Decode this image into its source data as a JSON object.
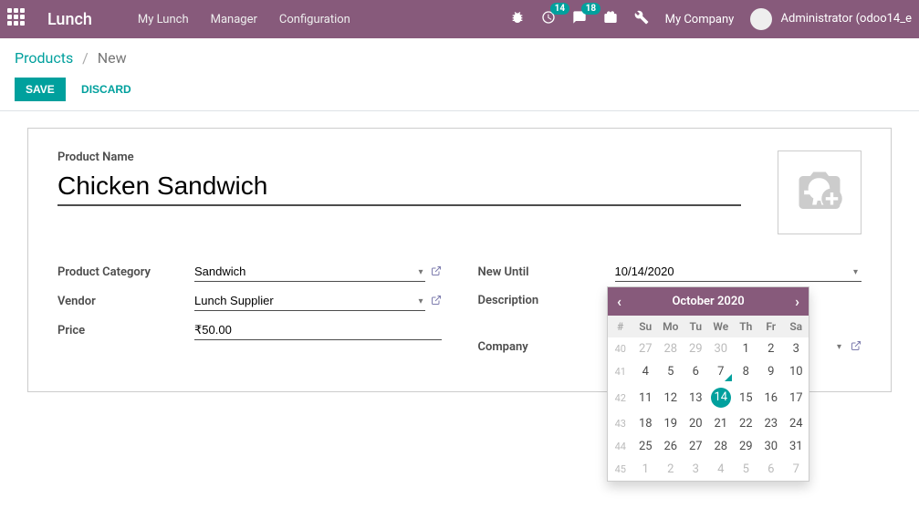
{
  "nav": {
    "brand": "Lunch",
    "links": [
      "My Lunch",
      "Manager",
      "Configuration"
    ],
    "badge_activities": "14",
    "badge_discuss": "18",
    "company": "My Company",
    "user": "Administrator (odoo14_e"
  },
  "breadcrumb": {
    "parent": "Products",
    "current": "New"
  },
  "buttons": {
    "save": "SAVE",
    "discard": "DISCARD"
  },
  "form": {
    "product_name_label": "Product Name",
    "product_name": "Chicken Sandwich",
    "category_label": "Product Category",
    "category": "Sandwich",
    "vendor_label": "Vendor",
    "vendor": "Lunch Supplier",
    "price_label": "Price",
    "price": "₹50.00",
    "new_until_label": "New Until",
    "new_until": "10/14/2020",
    "description_label": "Description",
    "company_label": "Company"
  },
  "datepicker": {
    "title": "October 2020",
    "dow": [
      "#",
      "Su",
      "Mo",
      "Tu",
      "We",
      "Th",
      "Fr",
      "Sa"
    ],
    "weeks": [
      {
        "num": "40",
        "days": [
          {
            "d": "27",
            "o": true
          },
          {
            "d": "28",
            "o": true
          },
          {
            "d": "29",
            "o": true
          },
          {
            "d": "30",
            "o": true
          },
          {
            "d": "1"
          },
          {
            "d": "2"
          },
          {
            "d": "3"
          }
        ]
      },
      {
        "num": "41",
        "days": [
          {
            "d": "4"
          },
          {
            "d": "5"
          },
          {
            "d": "6"
          },
          {
            "d": "7",
            "today": true
          },
          {
            "d": "8"
          },
          {
            "d": "9"
          },
          {
            "d": "10"
          }
        ]
      },
      {
        "num": "42",
        "days": [
          {
            "d": "11"
          },
          {
            "d": "12"
          },
          {
            "d": "13"
          },
          {
            "d": "14",
            "sel": true
          },
          {
            "d": "15"
          },
          {
            "d": "16"
          },
          {
            "d": "17"
          }
        ]
      },
      {
        "num": "43",
        "days": [
          {
            "d": "18"
          },
          {
            "d": "19"
          },
          {
            "d": "20"
          },
          {
            "d": "21"
          },
          {
            "d": "22"
          },
          {
            "d": "23"
          },
          {
            "d": "24"
          }
        ]
      },
      {
        "num": "44",
        "days": [
          {
            "d": "25"
          },
          {
            "d": "26"
          },
          {
            "d": "27"
          },
          {
            "d": "28"
          },
          {
            "d": "29"
          },
          {
            "d": "30"
          },
          {
            "d": "31"
          }
        ]
      },
      {
        "num": "45",
        "days": [
          {
            "d": "1",
            "o": true
          },
          {
            "d": "2",
            "o": true
          },
          {
            "d": "3",
            "o": true
          },
          {
            "d": "4",
            "o": true
          },
          {
            "d": "5",
            "o": true
          },
          {
            "d": "6",
            "o": true
          },
          {
            "d": "7",
            "o": true
          }
        ]
      }
    ]
  }
}
